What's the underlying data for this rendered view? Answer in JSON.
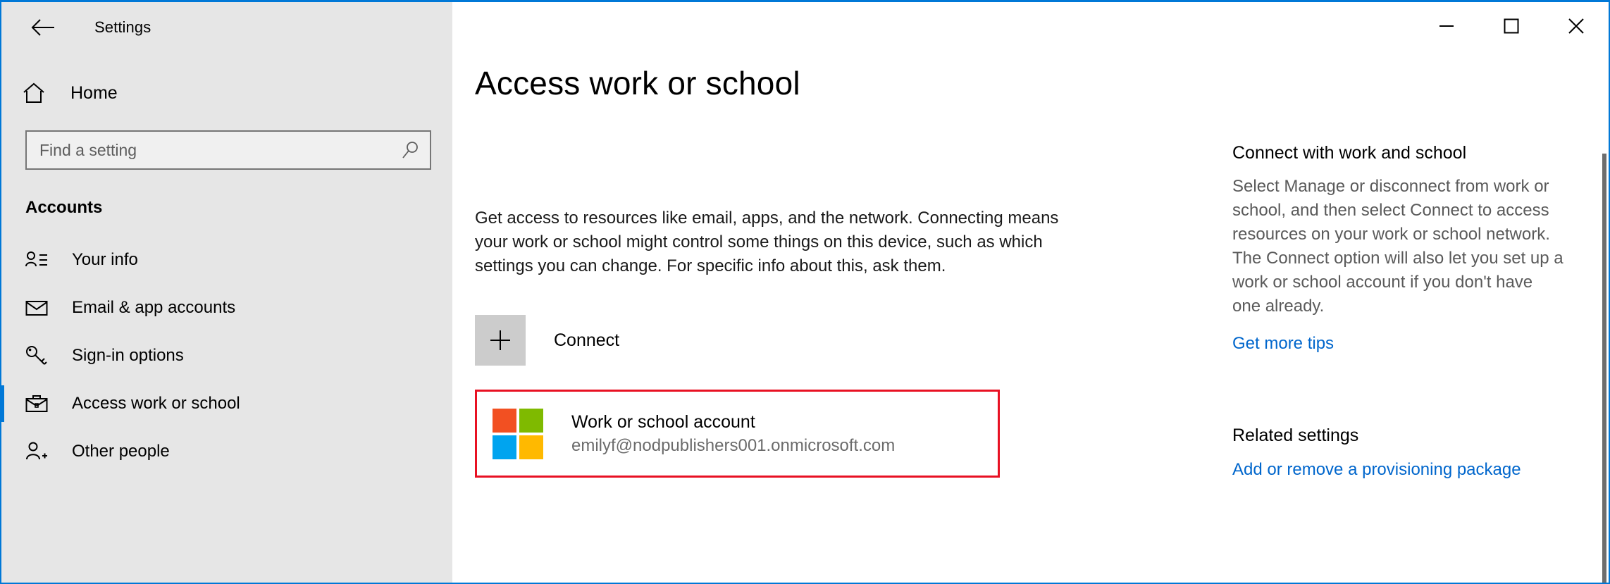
{
  "window": {
    "app_title": "Settings",
    "back_icon": "back-arrow-icon",
    "minimize_label": "—",
    "maximize_label": "□",
    "close_label": "✕"
  },
  "sidebar": {
    "home_label": "Home",
    "home_icon": "home-icon",
    "search": {
      "placeholder": "Find a setting",
      "value": "",
      "icon": "search-icon"
    },
    "section_title": "Accounts",
    "items": [
      {
        "label": "Your info",
        "icon": "user-info-icon",
        "selected": false
      },
      {
        "label": "Email & app accounts",
        "icon": "envelope-icon",
        "selected": false
      },
      {
        "label": "Sign-in options",
        "icon": "key-icon",
        "selected": false
      },
      {
        "label": "Access work or school",
        "icon": "briefcase-icon",
        "selected": true
      },
      {
        "label": "Other people",
        "icon": "add-person-icon",
        "selected": false
      }
    ]
  },
  "main": {
    "page_title": "Access work or school",
    "intro_text": "Get access to resources like email, apps, and the network. Connecting means your work or school might control some things on this device, such as which settings you can change. For specific info about this, ask them.",
    "connect": {
      "label": "Connect",
      "icon": "plus-icon"
    },
    "account": {
      "name": "Work or school account",
      "email": "emilyf@nodpublishers001.onmicrosoft.com",
      "icon": "microsoft-logo-icon",
      "highlighted": true,
      "highlight_color": "#e81123",
      "logo_colors": {
        "top_left": "#f25022",
        "top_right": "#7fba00",
        "bottom_left": "#00a4ef",
        "bottom_right": "#ffb900"
      }
    }
  },
  "right_rail": {
    "connect_heading": "Connect with work and school",
    "connect_body": "Select Manage or disconnect from work or school, and then select Connect to access resources on your work or school network. The Connect option will also let you set up a work or school account if you don't have one already.",
    "get_more_tips": "Get more tips",
    "related_heading": "Related settings",
    "related_link": "Add or remove a provisioning package"
  },
  "colors": {
    "accent": "#0078d7",
    "sidebar_bg": "#e6e6e6",
    "link": "#0066cc",
    "highlight_red": "#e81123"
  }
}
